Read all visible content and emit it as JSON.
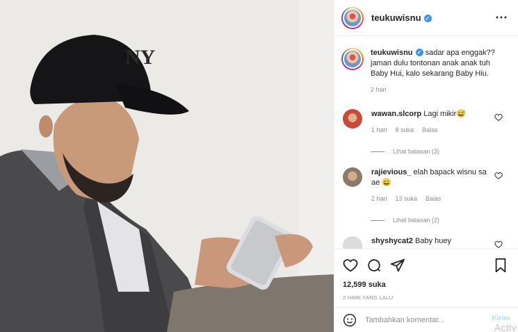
{
  "post": {
    "username": "teukuwisnu",
    "verified_mark": "✓",
    "more_icon": "⋯"
  },
  "caption": {
    "username": "teukuwisnu",
    "text": "sadar apa enggak?? jaman dulu tontonan anak anak tuh Baby Hui, kalo sekarang Baby Hiu.",
    "time": "2 hari"
  },
  "comments": [
    {
      "username": "wawan.slcorp",
      "text": "Lagi mikir😅",
      "time": "1 hari",
      "likes": "8 suka",
      "reply": "Balas",
      "view_replies": "Lihat balasan (3)",
      "avatar_color": "#c94a3a"
    },
    {
      "username": "rajievious_",
      "text": "elah bapack wisnu sa ae 😄",
      "time": "2 hari",
      "likes": "13 suka",
      "reply": "Balas",
      "view_replies": "Lihat balasan (2)",
      "avatar_color": "#8a7a6a"
    },
    {
      "username": "shyshycat2",
      "text": "Baby huey",
      "avatar_color": "#d8d8d8"
    }
  ],
  "actions": {
    "like_icon": "heart-icon",
    "comment_icon": "comment-icon",
    "share_icon": "share-icon",
    "save_icon": "bookmark-icon"
  },
  "likes_count": "12,599 suka",
  "date": "2 HARI YANG LALU",
  "add_comment": {
    "placeholder": "Tambahkan komentar...",
    "post_label": "Kirim",
    "emoji_icon": "smiley-icon"
  },
  "watermark": "Activ"
}
